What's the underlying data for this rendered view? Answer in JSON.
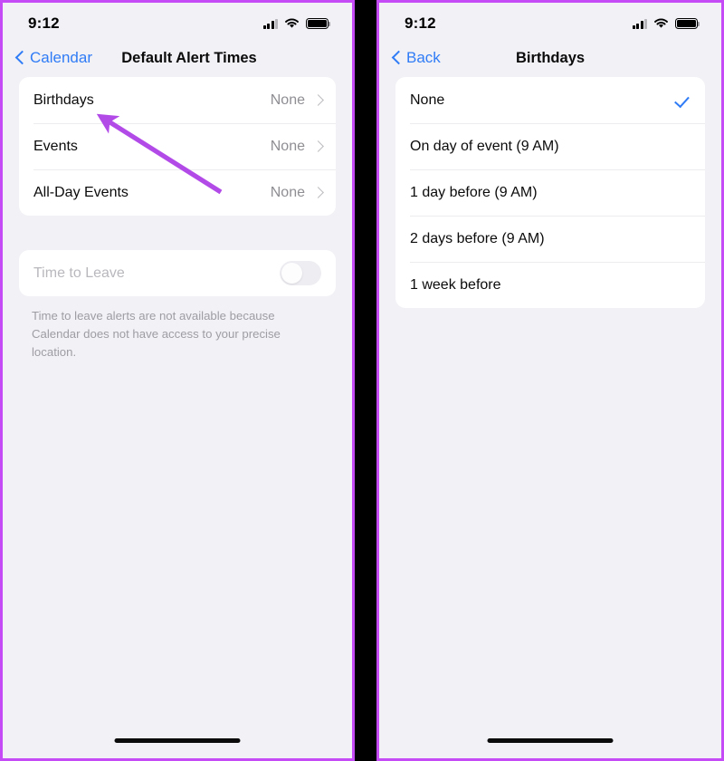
{
  "accent": {
    "frame_purple": "#c44bf5",
    "ios_blue": "#2f7cf6",
    "arrow_purple": "#b24ae8",
    "background": "#f2f1f6",
    "card": "#ffffff"
  },
  "left_panel": {
    "status_bar": {
      "time": "9:12",
      "cellular_icon": "signal-bars-icon",
      "wifi_icon": "wifi-icon",
      "battery_icon": "battery-full-icon"
    },
    "nav": {
      "back_icon": "chevron-left-icon",
      "back_label": "Calendar",
      "title": "Default Alert Times"
    },
    "alert_rows": [
      {
        "label": "Birthdays",
        "value": "None",
        "accessory": "chevron-right-icon"
      },
      {
        "label": "Events",
        "value": "None",
        "accessory": "chevron-right-icon"
      },
      {
        "label": "All-Day Events",
        "value": "None",
        "accessory": "chevron-right-icon"
      }
    ],
    "time_to_leave": {
      "label": "Time to Leave",
      "toggle_state": "off",
      "toggle_enabled": false
    },
    "footnote": "Time to leave alerts are not available because Calendar does not have access to your precise location."
  },
  "right_panel": {
    "status_bar": {
      "time": "9:12",
      "cellular_icon": "signal-bars-icon",
      "wifi_icon": "wifi-icon",
      "battery_icon": "battery-full-icon"
    },
    "nav": {
      "back_icon": "chevron-left-icon",
      "back_label": "Back",
      "title": "Birthdays"
    },
    "options": [
      {
        "label": "None",
        "selected": true
      },
      {
        "label": "On day of event (9 AM)",
        "selected": false
      },
      {
        "label": "1 day before (9 AM)",
        "selected": false
      },
      {
        "label": "2 days before (9 AM)",
        "selected": false
      },
      {
        "label": "1 week before",
        "selected": false
      }
    ]
  },
  "annotation": {
    "type": "arrow",
    "points_to": "Birthdays",
    "color": "#b24ae8"
  }
}
